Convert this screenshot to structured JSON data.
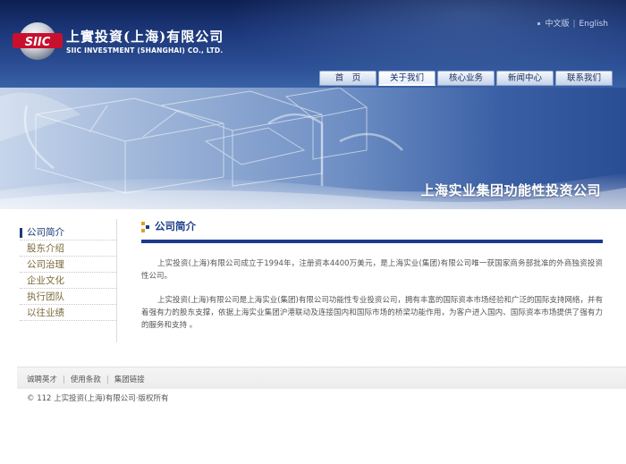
{
  "header": {
    "logo_cn": "上實投資(上海)有限公司",
    "logo_en": "SIIC INVESTMENT (SHANGHAI) CO., LTD.",
    "logo_mark": "SIIC",
    "lang": {
      "zh": "中文版",
      "en": "English"
    }
  },
  "nav": {
    "items": [
      {
        "label": "首　页"
      },
      {
        "label": "关于我们"
      },
      {
        "label": "核心业务"
      },
      {
        "label": "新闻中心"
      },
      {
        "label": "联系我们"
      }
    ]
  },
  "banner": {
    "title": "上海实业集团功能性投资公司"
  },
  "sidebar": {
    "items": [
      {
        "label": "公司简介"
      },
      {
        "label": "股东介绍"
      },
      {
        "label": "公司治理"
      },
      {
        "label": "企业文化"
      },
      {
        "label": "执行团队"
      },
      {
        "label": "以往业绩"
      }
    ]
  },
  "content": {
    "title": "公司简介",
    "paragraphs": [
      "上实投资(上海)有限公司成立于1994年，注册资本4400万美元，是上海实业(集团)有限公司唯一获国家商务部批准的外商独资投资性公司。",
      "上实投资(上海)有限公司是上海实业(集团)有限公司功能性专业投资公司，拥有丰富的国际资本市场经验和广泛的国际支持网络，并有着强有力的股东支撑，依据上海实业集团沪港联动及连接国内和国际市场的桥梁功能作用，为客户进入国内、国际资本市场提供了强有力的服务和支持 。"
    ]
  },
  "footer": {
    "links": [
      "诚聘英才",
      "使用条款",
      "集团链接"
    ],
    "copyright": "© 112 上实投资(上海)有限公司·版权所有"
  },
  "colors": {
    "primary": "#1a3b8c",
    "header_dark": "#0d1f52",
    "side_text": "#7a6a3a",
    "logo_red": "#c8102e"
  }
}
